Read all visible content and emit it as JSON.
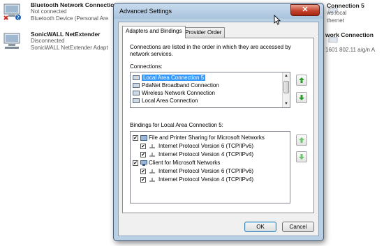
{
  "background": {
    "items": [
      {
        "name": "Bluetooth Network Connection",
        "status": "Not connected",
        "device": "Bluetooth Device (Personal Are"
      },
      {
        "name": "SonicWALL NetExtender",
        "status": "Disconnected",
        "device": "SonicWALL NetExtender Adapt"
      }
    ],
    "right_texts": [
      "Connection 5",
      "ws.local",
      "thernet",
      "work Connection",
      "1601 802.11 a/g/n A"
    ]
  },
  "dialog": {
    "title": "Advanced Settings",
    "close_glyph": "✕",
    "tabs": [
      {
        "label": "Adapters and Bindings",
        "active": true
      },
      {
        "label": "Provider Order",
        "active": false
      }
    ],
    "description": "Connections are listed in the order in which they are accessed by network services.",
    "connections_label": "Connections:",
    "connections": [
      {
        "label": "Local Area Connection 5",
        "selected": true
      },
      {
        "label": "PdaNet Broadband Connection",
        "selected": false
      },
      {
        "label": "Wireless Network Connection",
        "selected": false
      },
      {
        "label": "Local Area Connection",
        "selected": false
      }
    ],
    "bindings_label": "Bindings for Local Area Connection 5:",
    "bindings": [
      {
        "label": "File and Printer Sharing for Microsoft Networks",
        "level": 0,
        "checked": true
      },
      {
        "label": "Internet Protocol Version 6 (TCP/IPv6)",
        "level": 1,
        "checked": true
      },
      {
        "label": "Internet Protocol Version 4 (TCP/IPv4)",
        "level": 1,
        "checked": true
      },
      {
        "label": "Client for Microsoft Networks",
        "level": 0,
        "checked": true
      },
      {
        "label": "Internet Protocol Version 6 (TCP/IPv6)",
        "level": 1,
        "checked": true
      },
      {
        "label": "Internet Protocol Version 4 (TCP/IPv4)",
        "level": 1,
        "checked": true
      }
    ],
    "ok_label": "OK",
    "cancel_label": "Cancel",
    "check_glyph": "✔"
  },
  "colors": {
    "selection": "#3399ff",
    "arrow_green": "#2e9e2e",
    "dialog_frame": "#b9cfe3"
  }
}
